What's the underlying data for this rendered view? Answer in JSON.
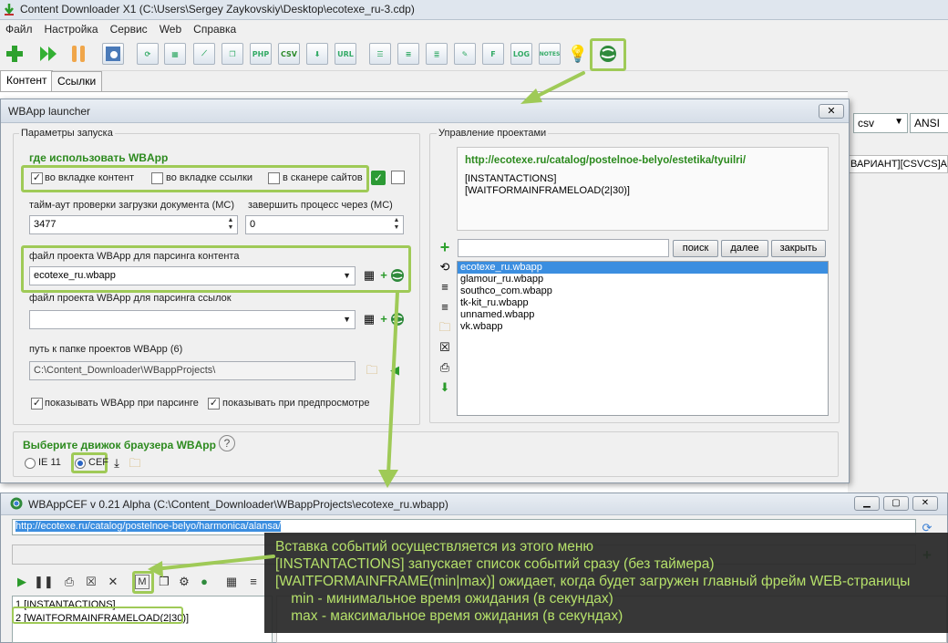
{
  "main_window": {
    "title": "Content Downloader X1 (C:\\Users\\Sergey Zaykovskiy\\Desktop\\ecotexe_ru-3.cdp)",
    "menu": [
      "Файл",
      "Настройка",
      "Сервис",
      "Web",
      "Справка"
    ],
    "toolbar_labels": {
      "php": "PHP",
      "csv": "CSV",
      "url": "URL",
      "f": "F",
      "log": "LOG",
      "notes": "NOTES"
    },
    "tabs": [
      "Контент",
      "Ссылки"
    ],
    "right_panel": {
      "format": "csv",
      "encoding": "ANSI",
      "variant_text": "ВАРИАНТ][CSVCS]АЙД"
    }
  },
  "launcher": {
    "title": "WBApp launcher",
    "close": "✕",
    "params_group": "Параметры запуска",
    "where_heading": "где использовать WBApp",
    "where_options": [
      {
        "label": "во вкладке контент",
        "checked": true
      },
      {
        "label": "во вкладке ссылки",
        "checked": false
      },
      {
        "label": "в сканере сайтов",
        "checked": false
      }
    ],
    "timeout_label": "тайм-аут проверки загрузки документа (МС)",
    "timeout_value": "3477",
    "finish_label": "завершить процесс через (МС)",
    "finish_value": "0",
    "content_project_label": "файл проекта WBApp для парсинга контента",
    "content_project_value": "ecotexe_ru.wbapp",
    "links_project_label": "файл проекта WBApp для парсинга ссылок",
    "links_project_value": "",
    "folder_label": "путь к папке проектов WBApp (6)",
    "folder_value": "C:\\Content_Downloader\\WBappProjects\\",
    "show_parse_label": "показывать WBApp при парсинге",
    "show_preview_label": "показывать при предпросмотре",
    "engine_heading": "Выберите движок браузера WBApp",
    "engine_help": "?",
    "engines": [
      {
        "label": "IE 11",
        "selected": false
      },
      {
        "label": "CEF",
        "selected": true
      }
    ],
    "manage_group": "Управление проектами",
    "project_url": "http://ecotexe.ru/catalog/postelnoe-belyo/estetika/tyuilri/",
    "project_events": [
      "[INSTANTACTIONS]",
      "[WAITFORMAINFRAMELOAD(2|30)]"
    ],
    "search_placeholder": "",
    "search_button": "поиск",
    "next_button": "далее",
    "close_button": "закрыть",
    "projects": [
      "ecotexe_ru.wbapp",
      "glamour_ru.wbapp",
      "southco_com.wbapp",
      "tk-kit_ru.wbapp",
      "unnamed.wbapp",
      "vk.wbapp"
    ],
    "selected_project": "ecotexe_ru.wbapp"
  },
  "cef_window": {
    "title": "WBAppCEF v 0.21 Alpha (C:\\Content_Downloader\\WBappProjects\\ecotexe_ru.wbapp)",
    "url": "http://ecotexe.ru/catalog/postelnoe-belyo/harmonica/alansa/",
    "events": [
      "1 [INSTANTACTIONS]",
      "2 [WAITFORMAINFRAMELOAD(2|30)]"
    ],
    "toolbar_marker": "M"
  },
  "annotation": {
    "lines": [
      "Вставка событий осуществляется из этого меню",
      "[INSTANTACTIONS] запускает список событий сразу (без таймера)",
      "[WAITFORMAINFRAME(min|max)] ожидает, когда будет загружен главный фрейм WEB-страницы",
      "    min - минимальное время ожидания (в секундах)",
      "    max - максимальное время ожидания (в секундах)"
    ]
  },
  "colors": {
    "highlight": "#9fca57",
    "heading_green": "#2c8a1e",
    "annotation_text": "#b5e06a",
    "selection": "#3b8ee0"
  }
}
